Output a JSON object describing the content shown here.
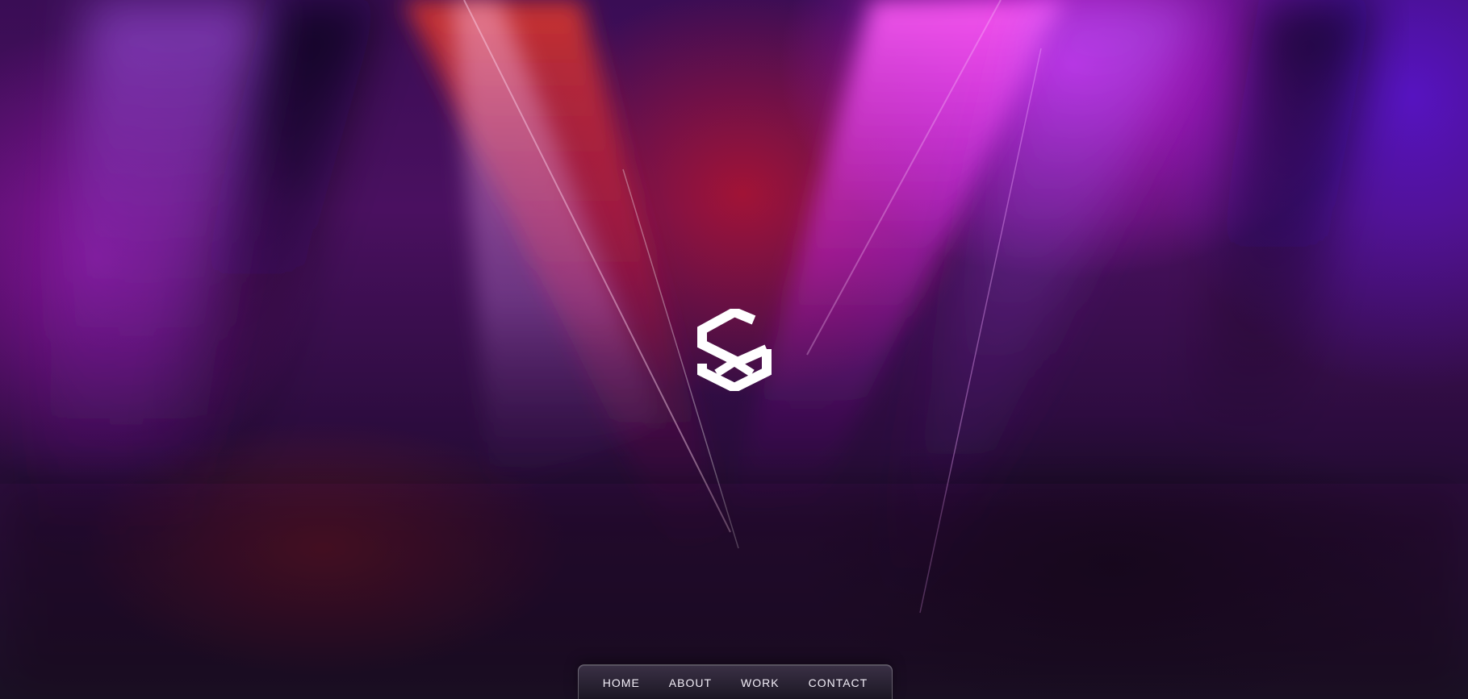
{
  "brand": {
    "logo_icon": "hexagon-s-logo-icon",
    "logo_color": "#ffffff"
  },
  "nav": {
    "items": [
      {
        "label": "HOME"
      },
      {
        "label": "ABOUT"
      },
      {
        "label": "WORK"
      },
      {
        "label": "CONTACT"
      }
    ]
  },
  "colors": {
    "background_dark": "#161221",
    "purple": "#4a1060",
    "magenta": "#dc1ef0",
    "red": "#be1428",
    "violet": "#5a14d2"
  }
}
